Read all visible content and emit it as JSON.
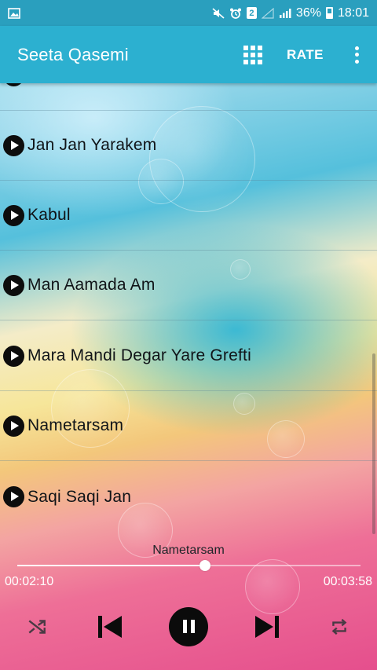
{
  "status_bar": {
    "sim_badge": "2",
    "battery_percent": "36%",
    "time": "18:01"
  },
  "app_bar": {
    "title": "Seeta Qasemi",
    "rate_label": "RATE",
    "icons": [
      "grid-icon",
      "more-vert-icon"
    ]
  },
  "songs": [
    {
      "title": "Jan Jan Yarakem"
    },
    {
      "title": "Kabul"
    },
    {
      "title": "Man Aamada Am"
    },
    {
      "title": "Mara Mandi Degar Yare Grefti"
    },
    {
      "title": "Nametarsam"
    },
    {
      "title": "Saqi Saqi Jan"
    }
  ],
  "player": {
    "now_playing": "Nametarsam",
    "elapsed": "00:02:10",
    "total": "00:03:58",
    "progress_fraction": 0.546,
    "controls": [
      "shuffle-icon",
      "previous-icon",
      "pause-icon",
      "next-icon",
      "repeat-icon"
    ]
  },
  "colors": {
    "status_bar": "#2a9fbe",
    "app_bar": "#2cb0d0",
    "accent_white": "#ffffff",
    "play_icon": "#0d0d0d"
  }
}
